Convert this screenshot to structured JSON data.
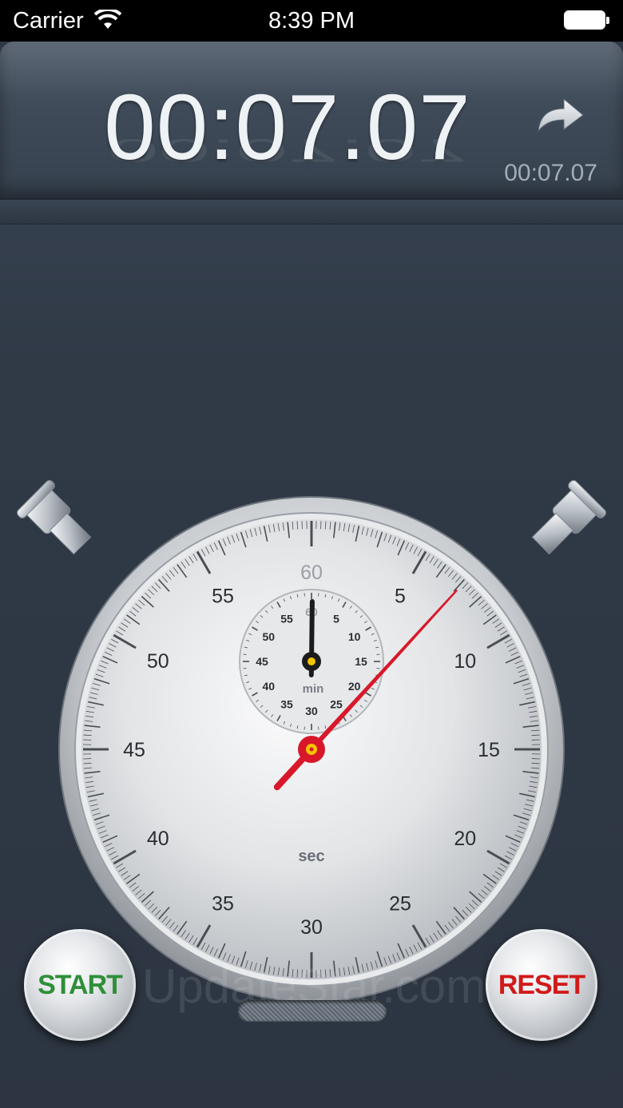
{
  "status_bar": {
    "carrier": "Carrier",
    "time": "8:39 PM",
    "icons": [
      "wifi-icon",
      "battery-icon"
    ]
  },
  "display": {
    "main_time": "00:07.07",
    "lap_time": "00:07.07",
    "share_icon": "share-arrow-icon"
  },
  "dial": {
    "second_labels": [
      "60",
      "5",
      "10",
      "15",
      "20",
      "25",
      "30",
      "35",
      "40",
      "45",
      "50",
      "55"
    ],
    "minute_labels": [
      "60",
      "5",
      "10",
      "15",
      "20",
      "25",
      "30",
      "35",
      "40",
      "45",
      "50",
      "55"
    ],
    "second_unit": "sec",
    "minute_unit": "min",
    "seconds_value": 7.07,
    "minutes_value": 0.118,
    "colors": {
      "second_hand": "#d8182a",
      "hub_center": "#f5c400",
      "minute_hand": "#1c1c1c"
    }
  },
  "controls": {
    "start_label": "START",
    "reset_label": "RESET",
    "start_color": "#2f8f3a",
    "reset_color": "#d11a1a"
  },
  "watermark": "UpdateStar.com"
}
